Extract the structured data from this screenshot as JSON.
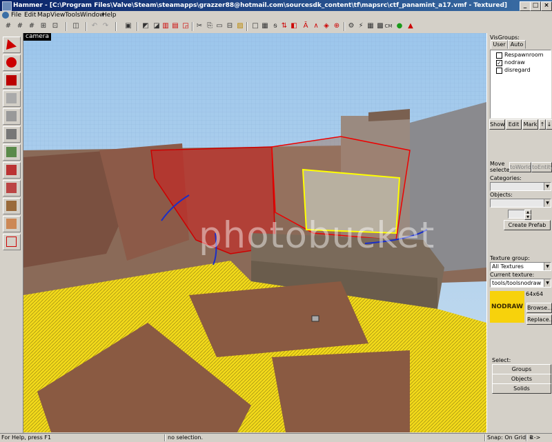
{
  "window": {
    "title": "Hammer - [C:\\Program Files\\Valve\\Steam\\steamapps\\grazzer88@hotmail.com\\sourcesdk_content\\tf\\mapsrc\\ctf_panamint_a17.vmf - Textured]"
  },
  "menu": [
    "File",
    "Edit",
    "Map",
    "View",
    "Tools",
    "Window",
    "Help"
  ],
  "viewport": {
    "label": "camera",
    "watermark": "photobucket"
  },
  "visgroups": {
    "title": "VisGroups:",
    "tabs": [
      "User",
      "Auto"
    ],
    "items": [
      {
        "label": "Respawnroom",
        "checked": false
      },
      {
        "label": "nodraw",
        "checked": true
      },
      {
        "label": "disregard",
        "checked": false
      }
    ],
    "buttons": {
      "show": "Show",
      "edit": "Edit",
      "mark": "Mark",
      "up": "↑",
      "down": "↓"
    }
  },
  "move": {
    "label_line1": "Move",
    "label_line2": "selected:",
    "to_world": "toWorld",
    "to_entity": "toEntity"
  },
  "categories": {
    "label": "Categories:",
    "value": ""
  },
  "objects": {
    "label": "Objects:",
    "value": ""
  },
  "prefab": {
    "button": "Create Prefab"
  },
  "texture": {
    "group_label": "Texture group:",
    "group_value": "All Textures",
    "current_label": "Current texture:",
    "current_value": "tools/toolsnodraw",
    "size": "64x64",
    "preview_text": "NODRAW",
    "browse": "Browse...",
    "replace": "Replace..."
  },
  "select": {
    "label": "Select:",
    "groups": "Groups",
    "objects": "Objects",
    "solids": "Solids"
  },
  "status": {
    "help": "For Help, press F1",
    "selection": "no selection.",
    "snap": "Snap: On Grid: 8",
    "arrows": "<->"
  },
  "colors": {
    "title_start": "#0a246a",
    "title_end": "#3a6ea5",
    "panel": "#d4d0c8",
    "nodraw": "#f7d20c"
  }
}
